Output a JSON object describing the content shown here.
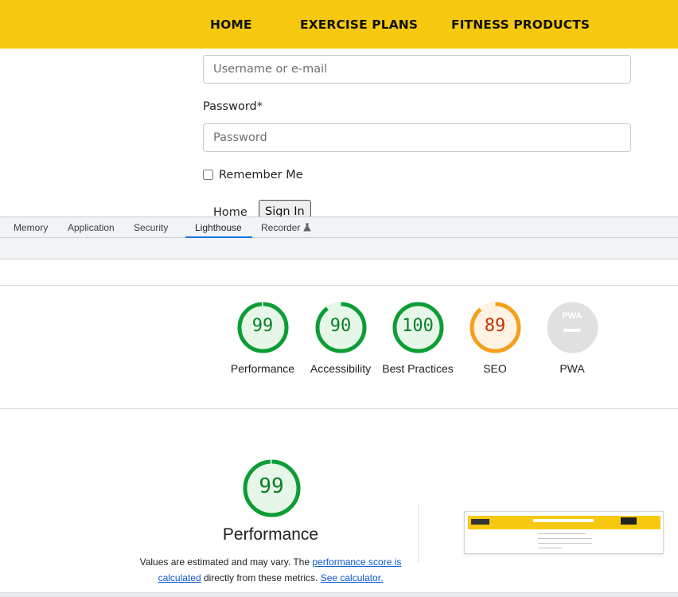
{
  "site": {
    "nav": [
      "HOME",
      "EXERCISE PLANS",
      "FITNESS PRODUCTS"
    ],
    "username_placeholder": "Username or e-mail",
    "password_label": "Password*",
    "password_placeholder": "Password",
    "remember_label": "Remember Me",
    "home_link": "Home",
    "signin_label": "Sign In"
  },
  "devtools": {
    "tabs": [
      {
        "label": "Memory",
        "active": false
      },
      {
        "label": "Application",
        "active": false
      },
      {
        "label": "Security",
        "active": false
      },
      {
        "label": "Lighthouse",
        "active": true
      },
      {
        "label": "Recorder",
        "active": false,
        "icon": "flask-icon"
      }
    ]
  },
  "lighthouse": {
    "scores": [
      {
        "value": "99",
        "label": "Performance",
        "status": "pass"
      },
      {
        "value": "90",
        "label": "Accessibility",
        "status": "pass"
      },
      {
        "value": "100",
        "label": "Best Practices",
        "status": "pass"
      },
      {
        "value": "89",
        "label": "SEO",
        "status": "average"
      },
      {
        "value": "",
        "label": "PWA",
        "status": "na",
        "badge": "PWA"
      }
    ],
    "performance": {
      "score": "99",
      "title": "Performance",
      "desc_prefix": "Values are estimated and may vary. The ",
      "desc_link1": "performance score is calculated",
      "desc_middle": " directly from these metrics. ",
      "desc_link2": "See calculator."
    },
    "colors": {
      "pass": "#0c9d35",
      "pass_fill": "#e6f7ea",
      "pass_text": "#0a7f25",
      "average": "#f59f1a",
      "average_fill": "#fff3e3",
      "average_text": "#c33300",
      "na": "#e0e0e0"
    }
  }
}
